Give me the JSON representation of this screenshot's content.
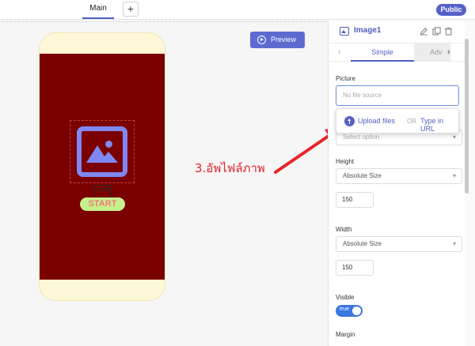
{
  "topbar": {
    "tab_main": "Main",
    "add_label": "+",
    "public_label": "Public"
  },
  "canvas": {
    "preview_label": "Preview",
    "image_label": "Label",
    "start_label": "START",
    "annotation": "3.อัพไฟล์ภาพ"
  },
  "panel": {
    "component_name": "Image1",
    "tabs": {
      "prev": "‹",
      "simple": "Simple",
      "advanced": "Adv",
      "next": "›"
    },
    "picture_label": "Picture",
    "picture_placeholder": "No file source",
    "upload_label": "Upload files",
    "or_label": "OR",
    "url_label": "Type in URL",
    "select_placeholder": "Select option",
    "height_label": "Height",
    "height_mode": "Absolute Size",
    "height_value": "150",
    "width_label": "Width",
    "width_mode": "Absolute Size",
    "width_value": "150",
    "visible_label": "Visible",
    "visible_value": "true",
    "margin_label": "Margin"
  },
  "colors": {
    "accent": "#4e5fbf",
    "screen_bg": "#7b0000",
    "annotation": "#e6242a"
  }
}
